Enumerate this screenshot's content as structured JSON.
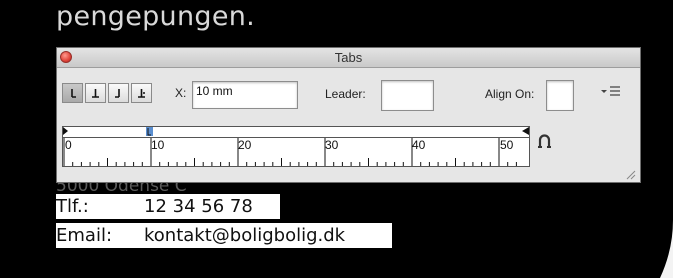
{
  "background": {
    "heading": "pengepungen.",
    "peek_text": "5000 Odense C",
    "contact": {
      "phone_label": "Tlf.:",
      "phone_value": "12 34 56 78",
      "email_label": "Email:",
      "email_value": "kontakt@boligbolig.dk"
    }
  },
  "tabs_panel": {
    "title": "Tabs",
    "x_label": "X:",
    "x_value": "10 mm",
    "leader_label": "Leader:",
    "leader_value": "",
    "align_on_label": "Align On:",
    "align_on_value": "",
    "alignment_buttons": [
      {
        "icon": "left-justified-tab-icon",
        "selected": true
      },
      {
        "icon": "center-justified-tab-icon",
        "selected": false
      },
      {
        "icon": "right-justified-tab-icon",
        "selected": false
      },
      {
        "icon": "align-to-decimal-tab-icon",
        "selected": false
      }
    ],
    "ruler": {
      "labels": [
        "0",
        "10",
        "20",
        "30",
        "40",
        "50"
      ],
      "tab_stop_mm": 10,
      "range_mm": [
        0,
        52
      ]
    }
  },
  "colors": {
    "close_button": "#e0443a",
    "panel_bg": "#e6e6e6",
    "tab_marker": "#5b8fd0"
  }
}
